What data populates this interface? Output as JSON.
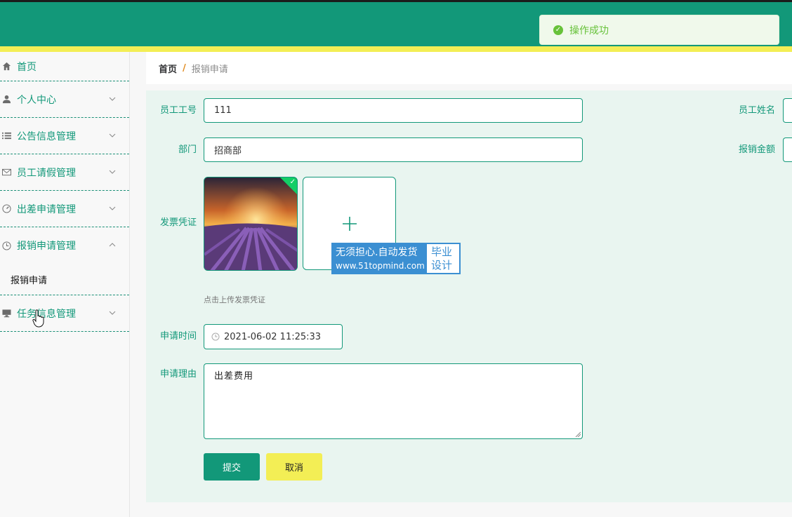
{
  "toast": {
    "message": "操作成功"
  },
  "sidebar": {
    "items": [
      {
        "label": "首页",
        "icon": "home-icon"
      },
      {
        "label": "个人中心",
        "icon": "user-icon"
      },
      {
        "label": "公告信息管理",
        "icon": "list-icon"
      },
      {
        "label": "员工请假管理",
        "icon": "mail-icon"
      },
      {
        "label": "出差申请管理",
        "icon": "gauge-icon"
      },
      {
        "label": "报销申请管理",
        "icon": "clock-icon",
        "expanded": true
      },
      {
        "label": "任务信息管理",
        "icon": "monitor-icon"
      }
    ],
    "subitems": [
      {
        "label": "报销申请"
      }
    ]
  },
  "breadcrumb": {
    "home": "首页",
    "separator": "/",
    "current": "报销申请"
  },
  "form": {
    "employee_no": {
      "label": "员工工号",
      "value": "111"
    },
    "employee_name": {
      "label": "员工姓名",
      "value": ""
    },
    "department": {
      "label": "部门",
      "value": "招商部"
    },
    "amount": {
      "label": "报销金额",
      "value": ""
    },
    "invoice": {
      "label": "发票凭证",
      "tip": "点击上传发票凭证"
    },
    "apply_time": {
      "label": "申请时间",
      "value": "2021-06-02 11:25:33"
    },
    "reason": {
      "label": "申请理由",
      "value": "出差费用"
    },
    "submit_label": "提交",
    "cancel_label": "取消"
  },
  "watermark": {
    "line1": "无须担心.自动发货",
    "line2": "www.51topmind.com",
    "right1": "毕业",
    "right2": "设计"
  },
  "colors": {
    "primary": "#129879",
    "accent_yellow": "#f3ee55",
    "success": "#67c23a"
  }
}
